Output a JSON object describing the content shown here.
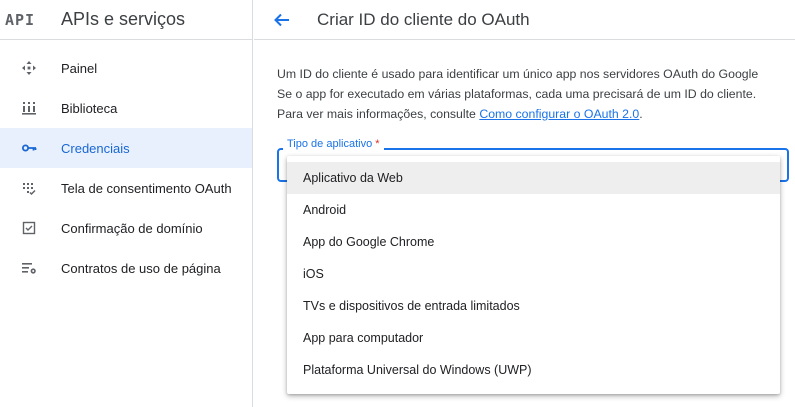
{
  "sidebar": {
    "logo": "API",
    "title": "APIs e serviços",
    "items": [
      {
        "label": "Painel",
        "icon": "dashboard-icon",
        "active": false
      },
      {
        "label": "Biblioteca",
        "icon": "library-icon",
        "active": false
      },
      {
        "label": "Credenciais",
        "icon": "key-icon",
        "active": true
      },
      {
        "label": "Tela de consentimento OAuth",
        "icon": "consent-screen-icon",
        "active": false
      },
      {
        "label": "Confirmação de domínio",
        "icon": "domain-verification-icon",
        "active": false
      },
      {
        "label": "Contratos de uso de página",
        "icon": "page-usage-agreements-icon",
        "active": false
      }
    ]
  },
  "header": {
    "title": "Criar ID do cliente do OAuth"
  },
  "description": {
    "line1": "Um ID do cliente é usado para identificar um único app nos servidores OAuth do Google",
    "line2": "Se o app for executado em várias plataformas, cada uma precisará de um ID do cliente.",
    "line3_prefix": "Para ver mais informações, consulte ",
    "link": "Como configurar o OAuth 2.0",
    "line3_suffix": "."
  },
  "app_type": {
    "label": "Tipo de aplicativo",
    "required_marker": "*",
    "options": [
      "Aplicativo da Web",
      "Android",
      "App do Google Chrome",
      "iOS",
      "TVs e dispositivos de entrada limitados",
      "App para computador",
      "Plataforma Universal do Windows (UWP)"
    ],
    "highlighted_index": 0
  },
  "colors": {
    "accent": "#1a73e8",
    "active_bg": "#e8f0fe",
    "required": "#d93025"
  }
}
